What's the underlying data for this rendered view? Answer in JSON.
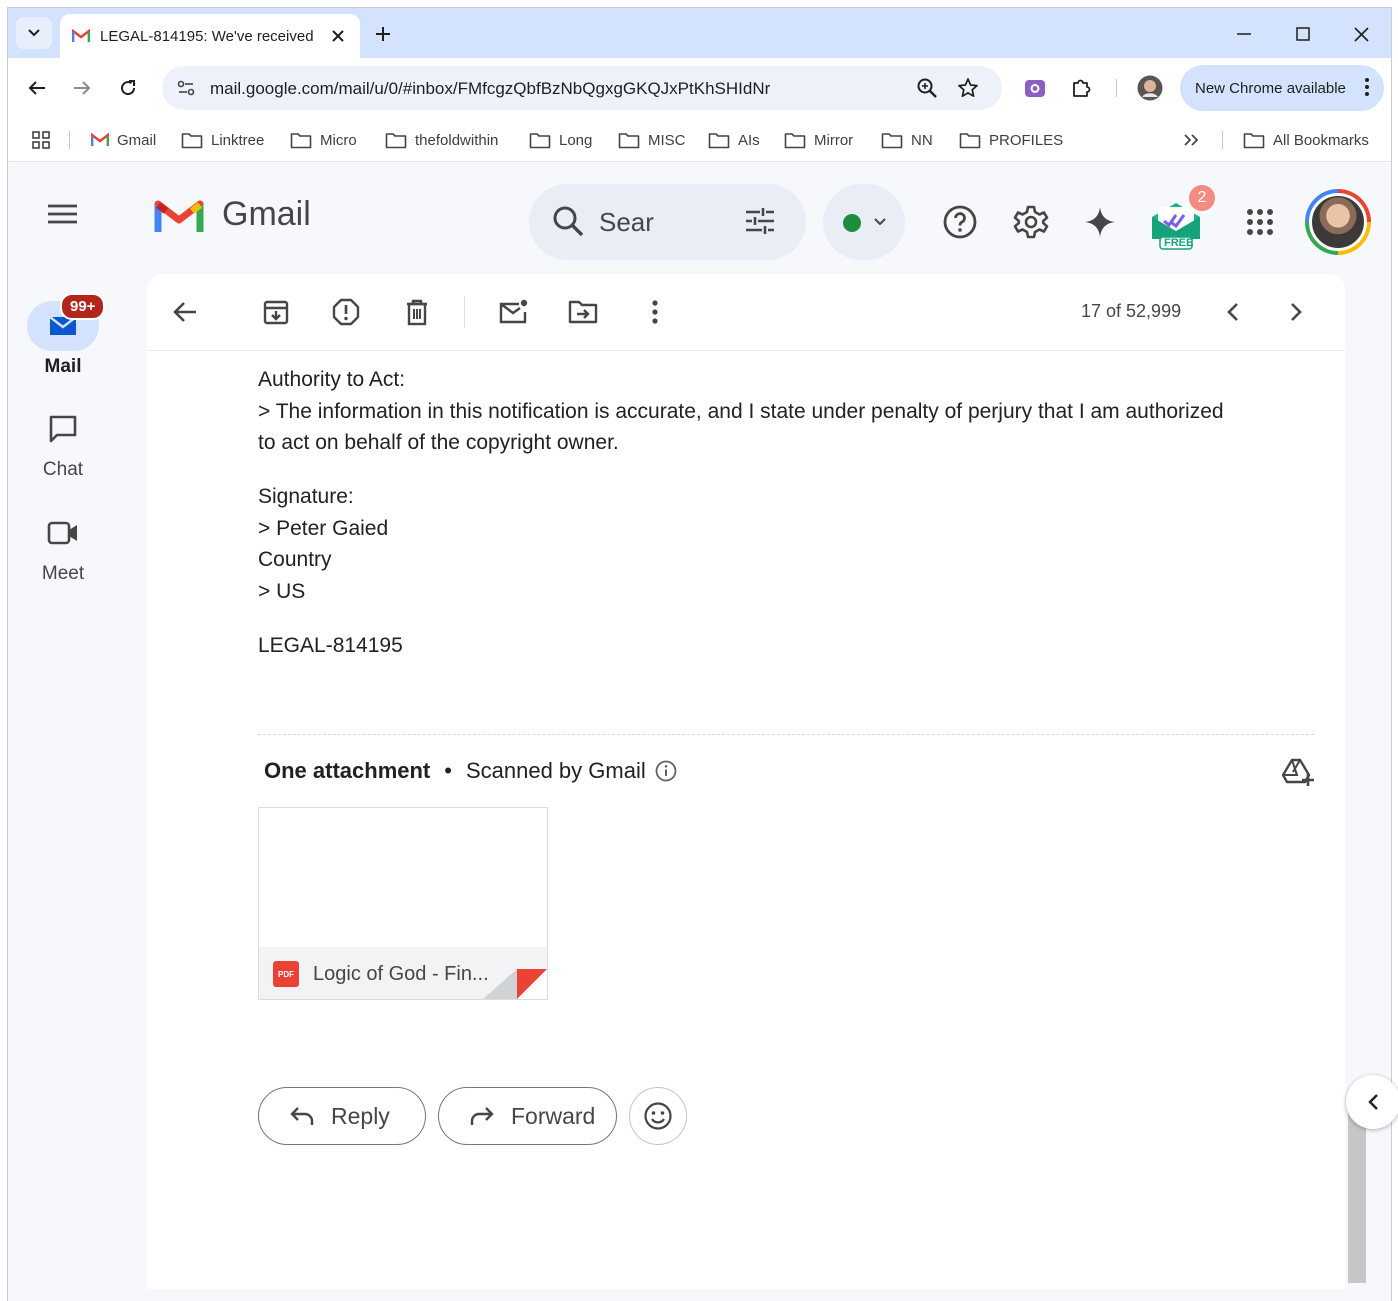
{
  "browser": {
    "tab_title": "LEGAL-814195: We've received",
    "url": "mail.google.com/mail/u/0/#inbox/FMfcgzQbfBzNbQgxgGKQJxPtKhSHIdNr",
    "update_button": "New Chrome available"
  },
  "bookmarks": {
    "items": [
      "Gmail",
      "Linktree",
      "Micro",
      "thefoldwithin",
      "Long",
      "MISC",
      "AIs",
      "Mirror",
      "NN",
      "PROFILES"
    ],
    "all": "All Bookmarks"
  },
  "gmail": {
    "logo_text": "Gmail",
    "search_placeholder": "Sear",
    "status_color": "#1e8e3e",
    "extension_badge": "2",
    "extension_label": "FREE",
    "accent": "#0b57d0"
  },
  "rail": {
    "mail": "Mail",
    "mail_badge": "99+",
    "chat": "Chat",
    "meet": "Meet"
  },
  "toolbar": {
    "pager": "17 of 52,999"
  },
  "message": {
    "authority_heading": "Authority to Act:",
    "authority_line1": "> The information in this notification is accurate, and I state under penalty of perjury that I am authorized",
    "authority_line2": "to act on behalf of the copyright owner.",
    "signature_heading": "Signature:",
    "signature_value": "> Peter Gaied",
    "country_heading": "Country",
    "country_value": "> US",
    "reference": "LEGAL-814195"
  },
  "attachments": {
    "heading": "One attachment",
    "scanned": "Scanned by Gmail",
    "file_type": "PDF",
    "file_name": "Logic of God - Fin..."
  },
  "actions": {
    "reply": "Reply",
    "forward": "Forward"
  }
}
